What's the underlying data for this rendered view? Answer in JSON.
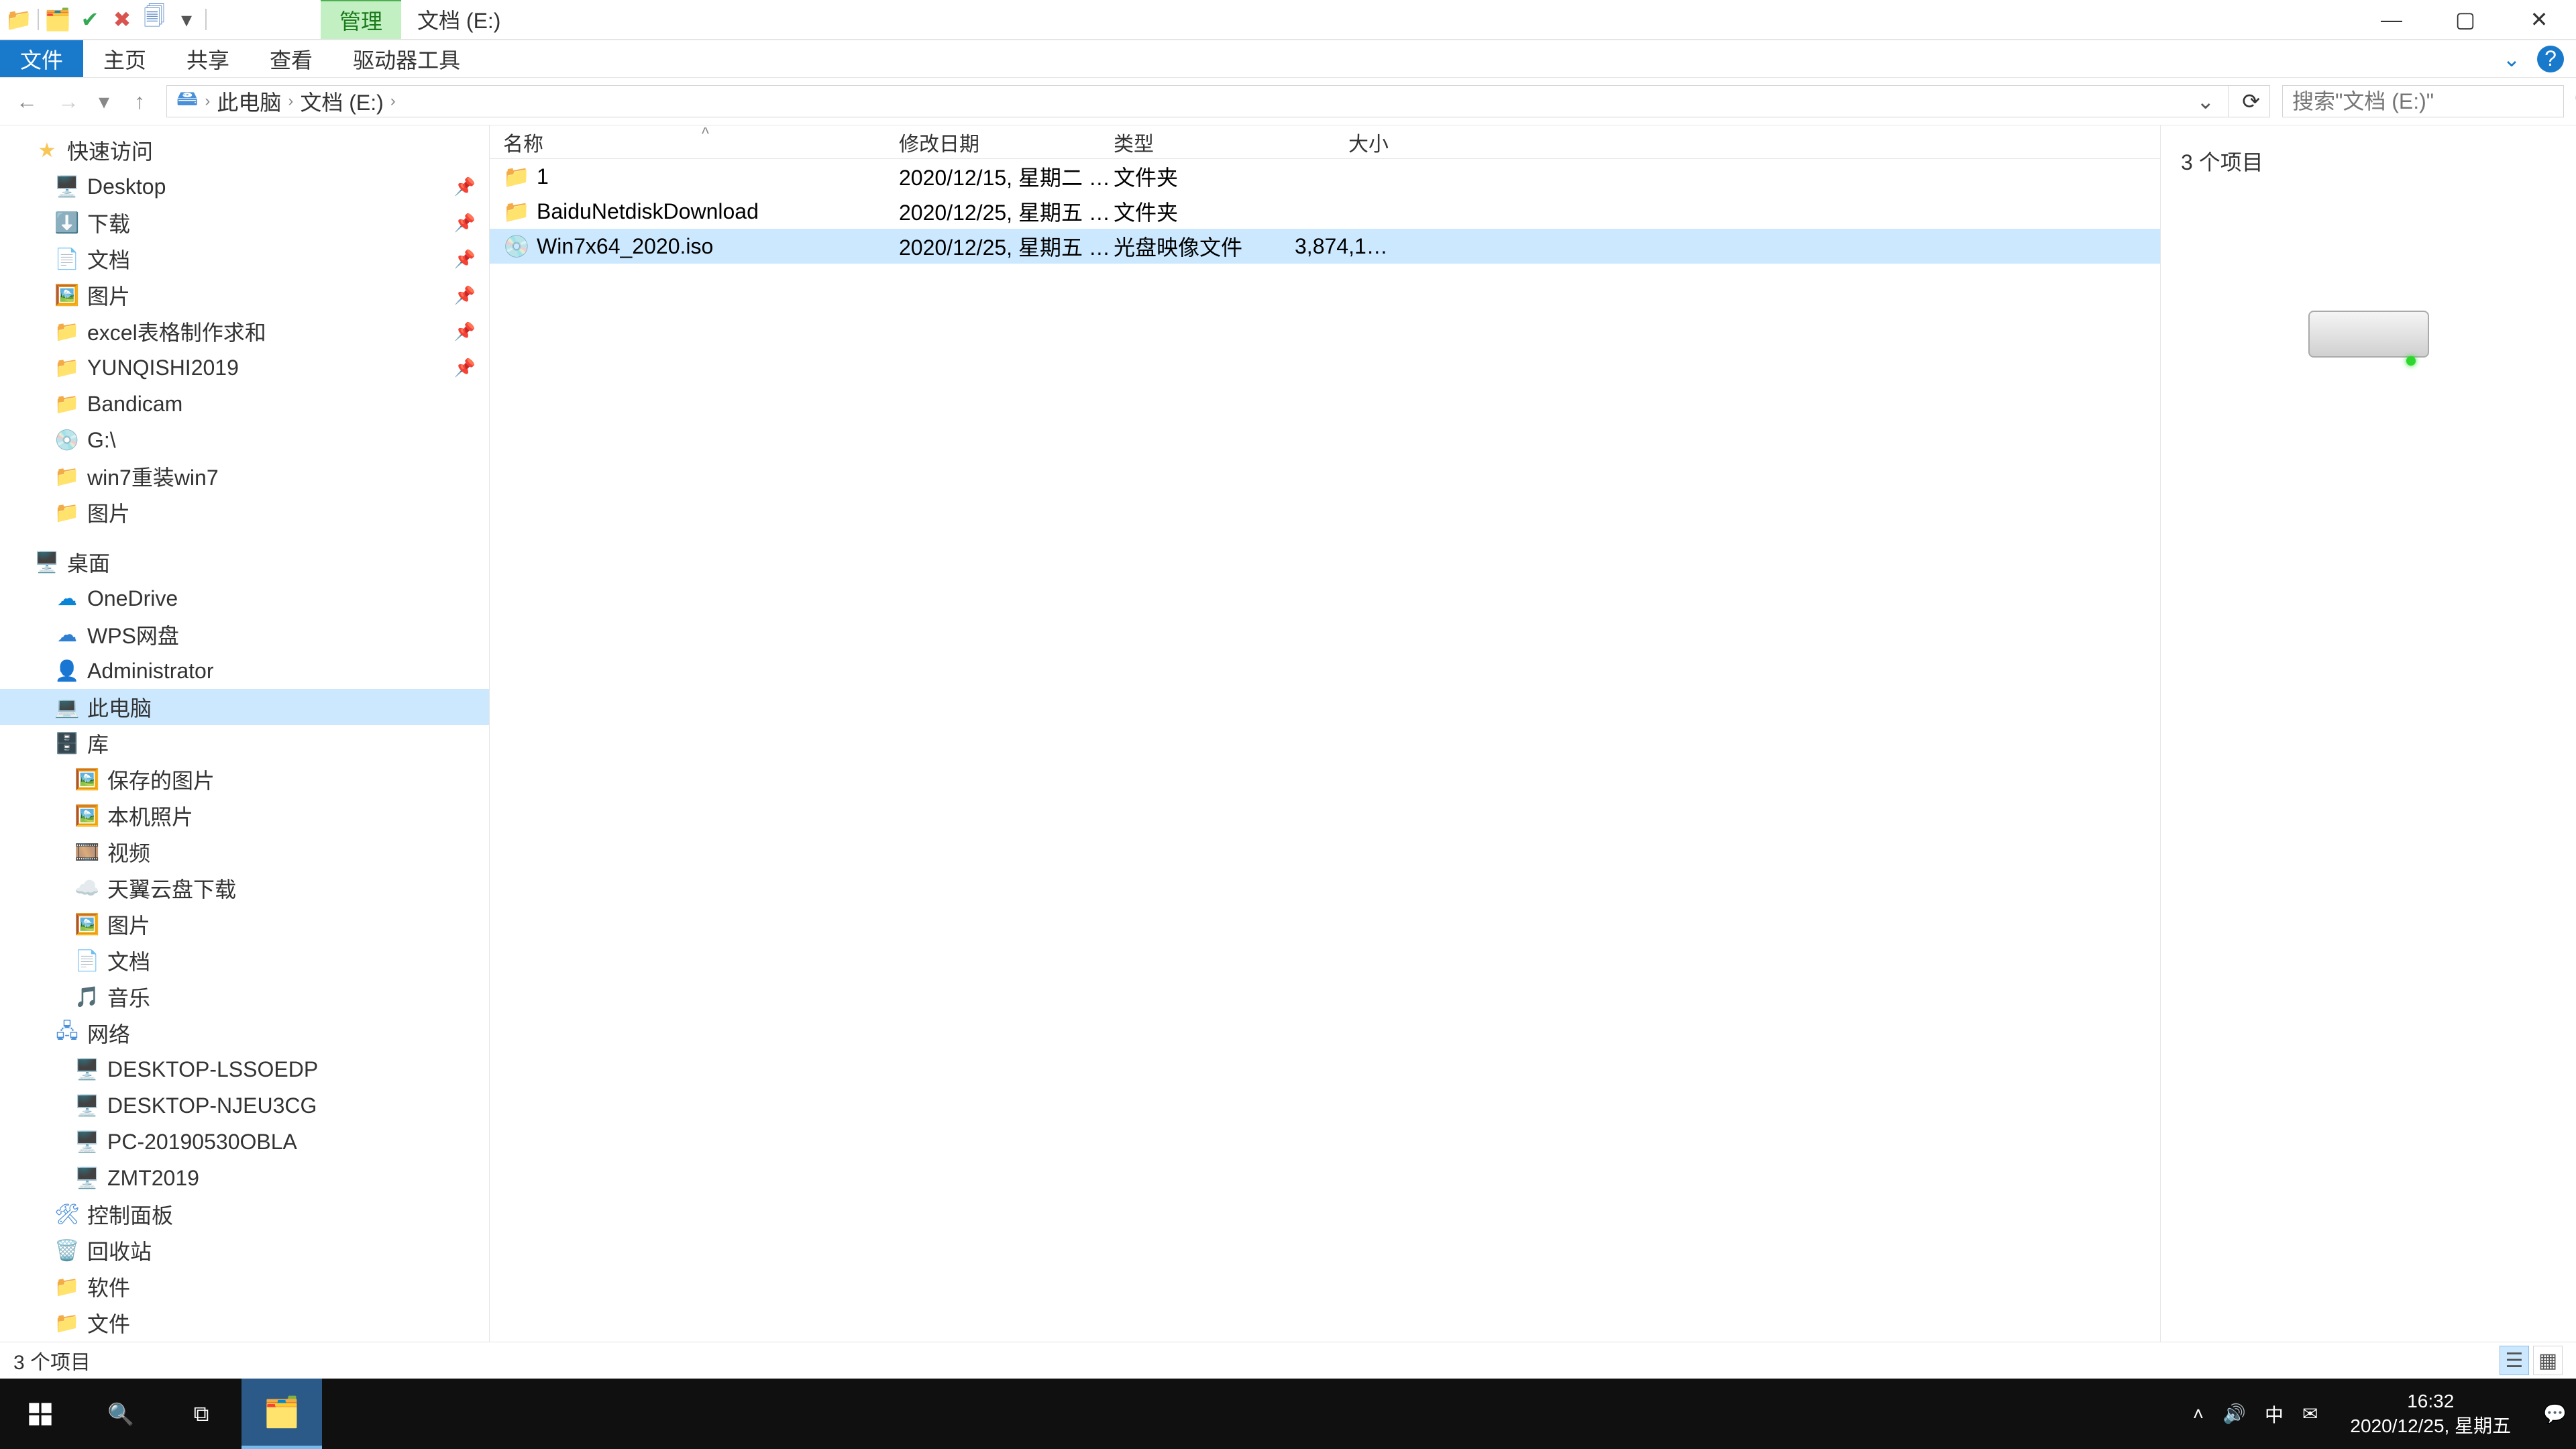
{
  "title_context_tab": "管理",
  "window_title": "文档 (E:)",
  "ribbon": {
    "file": "文件",
    "home": "主页",
    "share": "共享",
    "view": "查看",
    "drive_tools": "驱动器工具"
  },
  "breadcrumb": {
    "seg1": "此电脑",
    "seg2": "文档 (E:)"
  },
  "search_placeholder": "搜索\"文档 (E:)\"",
  "nav": {
    "quick": "快速访问",
    "pinned": [
      {
        "label": "Desktop",
        "icon": "🖥️"
      },
      {
        "label": "下载",
        "icon": "⬇️"
      },
      {
        "label": "文档",
        "icon": "📄"
      },
      {
        "label": "图片",
        "icon": "🖼️"
      },
      {
        "label": "excel表格制作求和",
        "icon": "📁"
      },
      {
        "label": "YUNQISHI2019",
        "icon": "📁"
      }
    ],
    "recent": [
      {
        "label": "Bandicam",
        "icon": "📁"
      },
      {
        "label": "G:\\",
        "icon": "💿"
      },
      {
        "label": "win7重装win7",
        "icon": "📁"
      },
      {
        "label": "图片",
        "icon": "📁"
      }
    ],
    "desktop": "桌面",
    "onedrive": "OneDrive",
    "wps": "WPS网盘",
    "admin": "Administrator",
    "thispc": "此电脑",
    "libraries": "库",
    "lib_items": [
      {
        "label": "保存的图片",
        "icon": "🖼️"
      },
      {
        "label": "本机照片",
        "icon": "🖼️"
      },
      {
        "label": "视频",
        "icon": "🎞️"
      },
      {
        "label": "天翼云盘下载",
        "icon": "☁️"
      },
      {
        "label": "图片",
        "icon": "🖼️"
      },
      {
        "label": "文档",
        "icon": "📄"
      },
      {
        "label": "音乐",
        "icon": "🎵"
      }
    ],
    "network": "网络",
    "net_items": [
      {
        "label": "DESKTOP-LSSOEDP"
      },
      {
        "label": "DESKTOP-NJEU3CG"
      },
      {
        "label": "PC-20190530OBLA"
      },
      {
        "label": "ZMT2019"
      }
    ],
    "control_panel": "控制面板",
    "recycle": "回收站",
    "soft": "软件",
    "file_folder": "文件"
  },
  "columns": {
    "name": "名称",
    "date": "修改日期",
    "type": "类型",
    "size": "大小"
  },
  "rows": [
    {
      "name": "1",
      "date": "2020/12/15, 星期二 1...",
      "type": "文件夹",
      "size": "",
      "icon": "folder",
      "selected": false
    },
    {
      "name": "BaiduNetdiskDownload",
      "date": "2020/12/25, 星期五 1...",
      "type": "文件夹",
      "size": "",
      "icon": "folder",
      "selected": false
    },
    {
      "name": "Win7x64_2020.iso",
      "date": "2020/12/25, 星期五 1...",
      "type": "光盘映像文件",
      "size": "3,874,126...",
      "icon": "iso",
      "selected": true
    }
  ],
  "preview_count": "3 个项目",
  "status_text": "3 个项目",
  "clock_time": "16:32",
  "clock_date": "2020/12/25, 星期五",
  "ime": "中"
}
